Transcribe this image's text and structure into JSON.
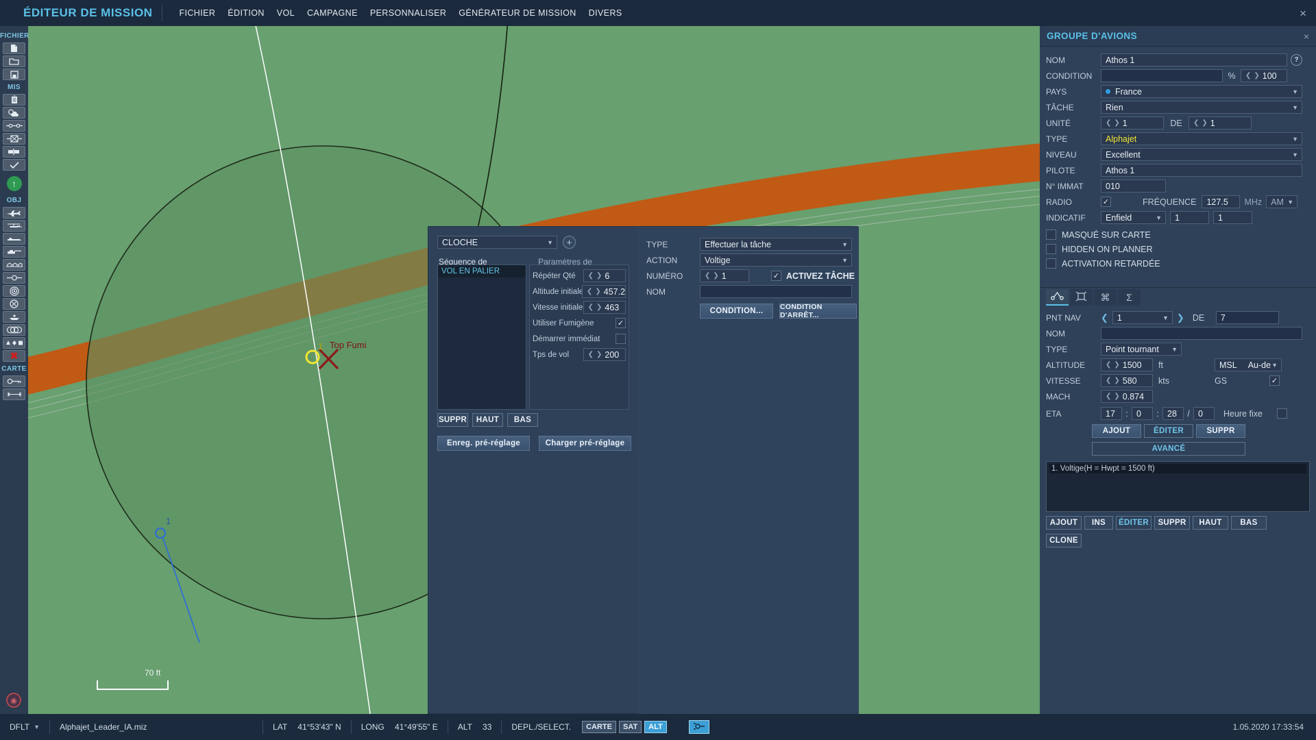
{
  "titlebar": {
    "app_title": "ÉDITEUR DE MISSION",
    "menus": [
      "FICHIER",
      "ÉDITION",
      "VOL",
      "CAMPAGNE",
      "PERSONNALISER",
      "GÉNÉRATEUR DE MISSION",
      "DIVERS"
    ],
    "close_label": "×"
  },
  "sidebar": {
    "groups": [
      {
        "label": "FICHIER",
        "items": [
          {
            "name": "new-mission",
            "icon": "page-icon"
          },
          {
            "name": "open-mission",
            "icon": "folder-icon"
          },
          {
            "name": "save-mission",
            "icon": "floppy-icon"
          }
        ]
      },
      {
        "label": "MIS",
        "items": [
          {
            "name": "briefing",
            "icon": "clipboard-icon"
          },
          {
            "name": "weather",
            "icon": "cloud-icon"
          },
          {
            "name": "trigger",
            "icon": "link-icon"
          },
          {
            "name": "failures",
            "icon": "node-icon"
          },
          {
            "name": "coalition",
            "icon": "flag-icon"
          },
          {
            "name": "validate",
            "icon": "check-icon"
          }
        ]
      },
      {
        "label": "OBJ",
        "items": [
          {
            "name": "airplane",
            "icon": "airplane-icon"
          },
          {
            "name": "helicopter",
            "icon": "helicopter-icon"
          },
          {
            "name": "ship",
            "icon": "ship-icon"
          },
          {
            "name": "vehicle",
            "icon": "tank-icon"
          },
          {
            "name": "structure",
            "icon": "bridge-icon"
          },
          {
            "name": "static-line",
            "icon": "line-node-icon"
          },
          {
            "name": "zone-circle",
            "icon": "target-icon"
          },
          {
            "name": "no-entry",
            "icon": "crossed-circle-icon"
          },
          {
            "name": "airfield",
            "icon": "dome-icon"
          },
          {
            "name": "formation",
            "icon": "rings-icon"
          },
          {
            "name": "shapes",
            "icon": "shapes-icon"
          },
          {
            "name": "delete-object",
            "icon": "red-x-icon"
          }
        ]
      },
      {
        "label": "CARTE",
        "items": [
          {
            "name": "map-key",
            "icon": "key-icon"
          },
          {
            "name": "map-ruler",
            "icon": "ruler-icon"
          }
        ]
      }
    ],
    "up_button_icon": "up-arrow-icon",
    "bottom_icon": "record-icon"
  },
  "map": {
    "scale_label": "70 ft",
    "markers": [
      {
        "label": "1",
        "sub": "Top Fumi",
        "type": "waypoint-cross",
        "color": "#8b1a1a"
      },
      {
        "label": "1",
        "type": "unit-start",
        "color": "#2f6fd0"
      }
    ],
    "colors": {
      "land": "#68a070",
      "road": "#c05a14",
      "zone": "#5d8f62"
    }
  },
  "dialog": {
    "preset_select": "CLOCHE",
    "add_button": "+",
    "tabs": [
      {
        "label": "Séquence de manoeuvres",
        "active": true
      },
      {
        "label": "Paramètres de manoeuvre",
        "active": false
      }
    ],
    "maneuver_list": [
      "VOL EN PALIER"
    ],
    "params": [
      {
        "label": "Répéter Qté",
        "value": "6",
        "kind": "spin"
      },
      {
        "label": "Altitude initiale",
        "value": "457.2",
        "kind": "spin"
      },
      {
        "label": "Vitesse initiale",
        "value": "463",
        "kind": "spin"
      },
      {
        "label": "Utiliser Fumigène",
        "value": "checked",
        "kind": "check"
      },
      {
        "label": "Démarrer immédiat",
        "value": "unchecked",
        "kind": "check"
      },
      {
        "label": "Tps de vol",
        "value": "200",
        "kind": "spin"
      }
    ],
    "list_buttons": [
      "SUPPR",
      "HAUT",
      "BAS"
    ],
    "preset_buttons": [
      "Enreg. pré-réglage",
      "Charger pré-réglage"
    ],
    "task": {
      "type_label": "TYPE",
      "type_value": "Effectuer la tâche",
      "action_label": "ACTION",
      "action_value": "Voltige",
      "numero_label": "NUMÉRO",
      "numero_value": "1",
      "activate_label": "ACTIVEZ TÂCHE",
      "activate_checked": true,
      "nom_label": "NOM",
      "nom_value": "",
      "condition_button": "CONDITION...",
      "stop_condition_button": "CONDITION D'ARRÊT..."
    }
  },
  "group_panel": {
    "title": "GROUPE D'AVIONS",
    "close_label": "×",
    "fields": {
      "nom_label": "NOM",
      "nom_value": "Athos 1",
      "help_label": "?",
      "condition_label": "CONDITION",
      "condition_value": "",
      "percent_label": "%",
      "percent_value": "100",
      "pays_label": "PAYS",
      "pays_value": "France",
      "tache_label": "TÂCHE",
      "tache_value": "Rien",
      "unite_label": "UNITÉ",
      "unite_value": "1",
      "de_label": "DE",
      "de_value": "1",
      "type_label": "TYPE",
      "type_value": "Alphajet",
      "niveau_label": "NIVEAU",
      "niveau_value": "Excellent",
      "pilote_label": "PILOTE",
      "pilote_value": "Athos 1",
      "immat_label": "N° IMMAT",
      "immat_value": "010",
      "radio_label": "RADIO",
      "radio_checked": true,
      "frequence_label": "FRÉQUENCE",
      "frequence_value": "127.5",
      "mhz_label": "MHz",
      "modulation_value": "AM",
      "indicatif_label": "INDICATIF",
      "indicatif_value": "Enfield",
      "indicatif_num1": "1",
      "indicatif_num2": "1"
    },
    "checkboxes": [
      {
        "label": "MASQUÉ SUR CARTE",
        "checked": false
      },
      {
        "label": "HIDDEN ON PLANNER",
        "checked": false
      },
      {
        "label": "ACTIVATION RETARDÉE",
        "checked": false
      }
    ],
    "nav_tabs": [
      {
        "icon": "route-icon",
        "active": true
      },
      {
        "icon": "payload-icon",
        "active": false
      },
      {
        "icon": "summary-icon",
        "active": false
      },
      {
        "icon": "sigma-icon",
        "active": false
      }
    ],
    "nav": {
      "pnt_nav_label": "PNT NAV",
      "pnt_nav_value": "1",
      "de_label": "DE",
      "de_value": "7",
      "nom_label": "NOM",
      "nom_value": "",
      "type_label": "TYPE",
      "type_value": "Point tournant",
      "altitude_label": "ALTITUDE",
      "altitude_value": "1500",
      "altitude_unit": "ft",
      "msl_label": "MSL",
      "msl_mode": "Au-de",
      "vitesse_label": "VITESSE",
      "vitesse_value": "580",
      "vitesse_unit": "kts",
      "gs_label": "GS",
      "gs_checked": true,
      "mach_label": "MACH",
      "mach_value": "0.874",
      "eta_label": "ETA",
      "eta_h": "17",
      "eta_m": "0",
      "eta_s": "28",
      "eta_d": "0",
      "heure_fixe_label": "Heure fixe",
      "heure_fixe_checked": false,
      "buttons": [
        "AJOUT",
        "ÉDITER",
        "SUPPR"
      ],
      "advanced_button": "AVANCÉ"
    },
    "route_list": [
      "1. Voltige(H = Hwpt = 1500 ft)"
    ],
    "route_buttons": [
      "AJOUT",
      "INS",
      "ÉDITER",
      "SUPPR",
      "HAUT",
      "BAS"
    ],
    "clone_button": "CLONE"
  },
  "statusbar": {
    "profile": "DFLT",
    "filename": "Alphajet_Leader_IA.miz",
    "lat_label": "LAT",
    "lat_value": "41°53'43\" N",
    "long_label": "LONG",
    "long_value": "41°49'55\" E",
    "alt_label": "ALT",
    "alt_value": "33",
    "mode_label": "DEPL./SELECT.",
    "toggles": [
      {
        "label": "CARTE",
        "on": false
      },
      {
        "label": "SAT",
        "on": false
      },
      {
        "label": "ALT",
        "on": true
      }
    ],
    "view_icon": "view-icon",
    "datetime": "1.05.2020 17:33:54"
  }
}
